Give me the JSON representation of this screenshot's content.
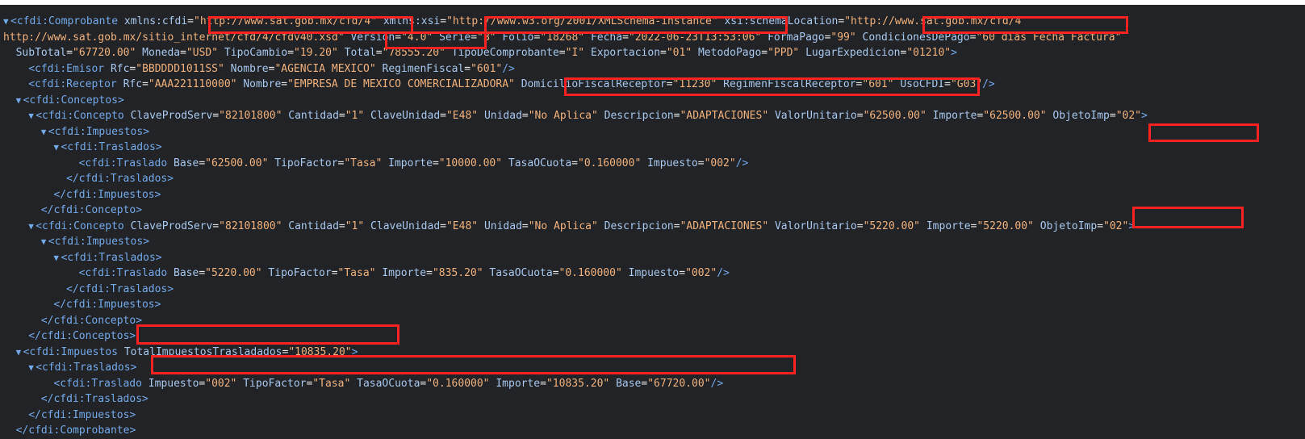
{
  "colors": {
    "background": "#222326",
    "tag": "#74a9e8",
    "attribute_name": "#a8c8ee",
    "attribute_value": "#f0b27e",
    "highlight": "#ff2222",
    "toggle_triangle": "#74a9e8"
  },
  "icons": {
    "toggle": "triangle-down-icon"
  },
  "lines": [
    {
      "indent": 0,
      "toggle": "▼",
      "html": "<span class=\"tag\">&lt;cfdi:Comprobante</span> <span class=\"an\">xmlns:cfdi</span>=<span class=\"av\">\"http://www.sat.gob.mx/cfd/4\"</span> <span class=\"an\">xmlns:xsi</span>=<span class=\"av\">\"http://www.w3.org/2001/XMLSchema-instance\"</span> <span class=\"an\">xsi:schemaLocation</span>=<span class=\"av\">\"http://www.sat.gob.mx/cfd/4</span>"
    },
    {
      "indent": 0,
      "toggle": "",
      "html": "<span class=\"av\">http://www.sat.gob.mx/sitio_internet/cfd/4/cfdv40.xsd\"</span> <span class=\"an\">Version</span>=<span class=\"av\">\"4.0\"</span> <span class=\"an\">Serie</span>=<span class=\"av\">\"B\"</span> <span class=\"an\">Folio</span>=<span class=\"av\">\"18268\"</span> <span class=\"an\">Fecha</span>=<span class=\"av\">\"2022-06-23T13:53:06\"</span> <span class=\"an\">FormaPago</span>=<span class=\"av\">\"99\"</span> <span class=\"an\">CondicionesDePago</span>=<span class=\"av\">\"60 días Fecha Factura\"</span>"
    },
    {
      "indent": 2,
      "toggle": "",
      "html": "<span class=\"an\">SubTotal</span>=<span class=\"av\">\"67720.00\"</span> <span class=\"an\">Moneda</span>=<span class=\"av\">\"USD\"</span> <span class=\"an\">TipoCambio</span>=<span class=\"av\">\"19.20\"</span> <span class=\"an\">Total</span>=<span class=\"av\">\"78555.20\"</span> <span class=\"an\">TipoDeComprobante</span>=<span class=\"av\">\"I\"</span> <span class=\"an\">Exportacion</span>=<span class=\"av\">\"01\"</span> <span class=\"an\">MetodoPago</span>=<span class=\"av\">\"PPD\"</span> <span class=\"an\">LugarExpedicion</span>=<span class=\"av\">\"01210\"</span><span class=\"tag\">&gt;</span>"
    },
    {
      "indent": 4,
      "toggle": "",
      "html": "<span class=\"tag\">&lt;cfdi:Emisor</span> <span class=\"an\">Rfc</span>=<span class=\"av\">\"BBDDDD1011SS\"</span> <span class=\"an\">Nombre</span>=<span class=\"av\">\"AGENCIA MEXICO\"</span> <span class=\"an\">RegimenFiscal</span>=<span class=\"av\">\"601\"</span><span class=\"tag\">/&gt;</span>"
    },
    {
      "indent": 4,
      "toggle": "",
      "html": "<span class=\"tag\">&lt;cfdi:Receptor</span> <span class=\"an\">Rfc</span>=<span class=\"av\">\"AAA221110000\"</span> <span class=\"an\">Nombre</span>=<span class=\"av\">\"EMPRESA DE MEXICO COMERCIALIZADORA\"</span> <span class=\"an\">DomicilioFiscalReceptor</span>=<span class=\"av\">\"11230\"</span> <span class=\"an\">RegimenFiscalReceptor</span>=<span class=\"av\">\"601\"</span> <span class=\"an\">UsoCFDI</span>=<span class=\"av\">\"G03\"</span><span class=\"tag\">/&gt;</span>"
    },
    {
      "indent": 2,
      "toggle": "▼",
      "html": "<span class=\"tag\">&lt;cfdi:Conceptos&gt;</span>"
    },
    {
      "indent": 4,
      "toggle": "▼",
      "html": "<span class=\"tag\">&lt;cfdi:Concepto</span> <span class=\"an\">ClaveProdServ</span>=<span class=\"av\">\"82101800\"</span> <span class=\"an\">Cantidad</span>=<span class=\"av\">\"1\"</span> <span class=\"an\">ClaveUnidad</span>=<span class=\"av\">\"E48\"</span> <span class=\"an\">Unidad</span>=<span class=\"av\">\"No Aplica\"</span> <span class=\"an\">Descripcion</span>=<span class=\"av\">\"ADAPTACIONES\"</span> <span class=\"an\">ValorUnitario</span>=<span class=\"av\">\"62500.00\"</span> <span class=\"an\">Importe</span>=<span class=\"av\">\"62500.00\"</span> <span class=\"an\">ObjetoImp</span>=<span class=\"av\">\"02\"</span><span class=\"tag\">&gt;</span>"
    },
    {
      "indent": 6,
      "toggle": "▼",
      "html": "<span class=\"tag\">&lt;cfdi:Impuestos&gt;</span>"
    },
    {
      "indent": 8,
      "toggle": "▼",
      "html": "<span class=\"tag\">&lt;cfdi:Traslados&gt;</span>"
    },
    {
      "indent": 12,
      "toggle": "",
      "html": "<span class=\"tag\">&lt;cfdi:Traslado</span> <span class=\"an\">Base</span>=<span class=\"av\">\"62500.00\"</span> <span class=\"an\">TipoFactor</span>=<span class=\"av\">\"Tasa\"</span> <span class=\"an\">Importe</span>=<span class=\"av\">\"10000.00\"</span> <span class=\"an\">TasaOCuota</span>=<span class=\"av\">\"0.160000\"</span> <span class=\"an\">Impuesto</span>=<span class=\"av\">\"002\"</span><span class=\"tag\">/&gt;</span>"
    },
    {
      "indent": 10,
      "toggle": "",
      "html": "<span class=\"tag\">&lt;/cfdi:Traslados&gt;</span>"
    },
    {
      "indent": 8,
      "toggle": "",
      "html": "<span class=\"tag\">&lt;/cfdi:Impuestos&gt;</span>"
    },
    {
      "indent": 6,
      "toggle": "",
      "html": "<span class=\"tag\">&lt;/cfdi:Concepto&gt;</span>"
    },
    {
      "indent": 4,
      "toggle": "▼",
      "html": "<span class=\"tag\">&lt;cfdi:Concepto</span> <span class=\"an\">ClaveProdServ</span>=<span class=\"av\">\"82101800\"</span> <span class=\"an\">Cantidad</span>=<span class=\"av\">\"1\"</span> <span class=\"an\">ClaveUnidad</span>=<span class=\"av\">\"E48\"</span> <span class=\"an\">Unidad</span>=<span class=\"av\">\"No Aplica\"</span> <span class=\"an\">Descripcion</span>=<span class=\"av\">\"ADAPTACIONES\"</span> <span class=\"an\">ValorUnitario</span>=<span class=\"av\">\"5220.00\"</span> <span class=\"an\">Importe</span>=<span class=\"av\">\"5220.00\"</span> <span class=\"an\">ObjetoImp</span>=<span class=\"av\">\"02\"</span><span class=\"tag\">&gt;</span>"
    },
    {
      "indent": 6,
      "toggle": "▼",
      "html": "<span class=\"tag\">&lt;cfdi:Impuestos&gt;</span>"
    },
    {
      "indent": 8,
      "toggle": "▼",
      "html": "<span class=\"tag\">&lt;cfdi:Traslados&gt;</span>"
    },
    {
      "indent": 12,
      "toggle": "",
      "html": "<span class=\"tag\">&lt;cfdi:Traslado</span> <span class=\"an\">Base</span>=<span class=\"av\">\"5220.00\"</span> <span class=\"an\">TipoFactor</span>=<span class=\"av\">\"Tasa\"</span> <span class=\"an\">Importe</span>=<span class=\"av\">\"835.20\"</span> <span class=\"an\">TasaOCuota</span>=<span class=\"av\">\"0.160000\"</span> <span class=\"an\">Impuesto</span>=<span class=\"av\">\"002\"</span><span class=\"tag\">/&gt;</span>"
    },
    {
      "indent": 10,
      "toggle": "",
      "html": "<span class=\"tag\">&lt;/cfdi:Traslados&gt;</span>"
    },
    {
      "indent": 8,
      "toggle": "",
      "html": "<span class=\"tag\">&lt;/cfdi:Impuestos&gt;</span>"
    },
    {
      "indent": 6,
      "toggle": "",
      "html": "<span class=\"tag\">&lt;/cfdi:Concepto&gt;</span>"
    },
    {
      "indent": 4,
      "toggle": "",
      "html": "<span class=\"tag\">&lt;/cfdi:Conceptos&gt;</span>"
    },
    {
      "indent": 2,
      "toggle": "▼",
      "html": "<span class=\"tag\">&lt;cfdi:Impuestos</span> <span class=\"an\">TotalImpuestosTrasladados</span>=<span class=\"av\">\"10835.20\"</span><span class=\"tag\">&gt;</span>"
    },
    {
      "indent": 4,
      "toggle": "▼",
      "html": "<span class=\"tag\">&lt;cfdi:Traslados&gt;</span>"
    },
    {
      "indent": 8,
      "toggle": "",
      "html": "<span class=\"tag\">&lt;cfdi:Traslado</span> <span class=\"an\">Impuesto</span>=<span class=\"av\">\"002\"</span> <span class=\"an\">TipoFactor</span>=<span class=\"av\">\"Tasa\"</span> <span class=\"an\">TasaOCuota</span>=<span class=\"av\">\"0.160000\"</span> <span class=\"an\">Importe</span>=<span class=\"av\">\"10835.20\"</span> <span class=\"an\">Base</span>=<span class=\"av\">\"67720.00\"</span><span class=\"tag\">/&gt;</span>"
    },
    {
      "indent": 6,
      "toggle": "",
      "html": "<span class=\"tag\">&lt;/cfdi:Traslados&gt;</span>"
    },
    {
      "indent": 4,
      "toggle": "",
      "html": "<span class=\"tag\">&lt;/cfdi:Impuestos&gt;</span>"
    },
    {
      "indent": 2,
      "toggle": "",
      "html": "<span class=\"tag\">&lt;/cfdi:Comprobante&gt;</span>"
    }
  ]
}
